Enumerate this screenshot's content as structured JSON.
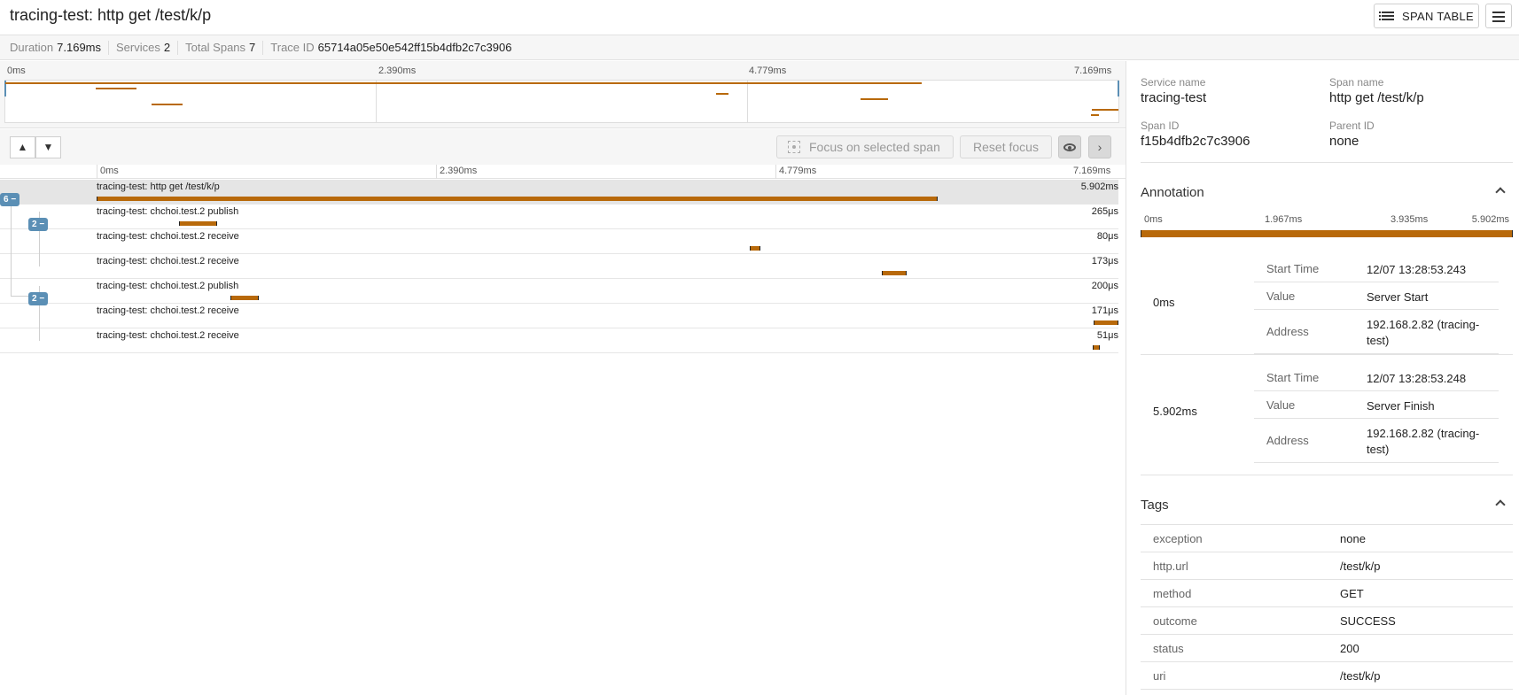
{
  "header": {
    "title": "tracing-test: http get /test/k/p",
    "span_table_label": "SPAN TABLE"
  },
  "stats": {
    "duration_label": "Duration",
    "duration_value": "7.169ms",
    "services_label": "Services",
    "services_value": "2",
    "spans_label": "Total Spans",
    "spans_value": "7",
    "trace_id_label": "Trace ID",
    "trace_id_value": "65714a05e50e542ff15b4dfb2c7c3906"
  },
  "timeline": {
    "ticks": [
      "0ms",
      "2.390ms",
      "4.779ms",
      "7.169ms"
    ],
    "total_ms": 7.169
  },
  "toolbar": {
    "focus_label": "Focus on selected span",
    "reset_label": "Reset focus"
  },
  "spans": [
    {
      "name": "tracing-test: http get /test/k/p",
      "duration": "5.902ms",
      "start_ms": 0.0,
      "dur_ms": 5.902,
      "depth": 0,
      "selected": true
    },
    {
      "name": "tracing-test: chchoi.test.2 publish",
      "duration": "265μs",
      "start_ms": 0.58,
      "dur_ms": 0.265,
      "depth": 1
    },
    {
      "name": "tracing-test: chchoi.test.2 receive",
      "duration": "80μs",
      "start_ms": 4.58,
      "dur_ms": 0.08,
      "depth": 2
    },
    {
      "name": "tracing-test: chchoi.test.2 receive",
      "duration": "173μs",
      "start_ms": 5.51,
      "dur_ms": 0.173,
      "depth": 2
    },
    {
      "name": "tracing-test: chchoi.test.2 publish",
      "duration": "200μs",
      "start_ms": 0.94,
      "dur_ms": 0.2,
      "depth": 1
    },
    {
      "name": "tracing-test: chchoi.test.2 receive",
      "duration": "171μs",
      "start_ms": 6.998,
      "dur_ms": 0.171,
      "depth": 2
    },
    {
      "name": "tracing-test: chchoi.test.2 receive",
      "duration": "51μs",
      "start_ms": 6.99,
      "dur_ms": 0.051,
      "depth": 2
    }
  ],
  "badges": [
    {
      "label": "6 −"
    },
    {
      "label": "2 −"
    },
    {
      "label": "2 −"
    }
  ],
  "detail": {
    "service_name_label": "Service name",
    "service_name_value": "tracing-test",
    "span_name_label": "Span name",
    "span_name_value": "http get /test/k/p",
    "span_id_label": "Span ID",
    "span_id_value": "f15b4dfb2c7c3906",
    "parent_id_label": "Parent ID",
    "parent_id_value": "none",
    "annotation_title": "Annotation",
    "annotation_ticks": [
      "0ms",
      "1.967ms",
      "3.935ms",
      "5.902ms"
    ],
    "annotations": [
      {
        "time": "0ms",
        "rows": [
          {
            "key": "Start Time",
            "value": "12/07 13:28:53.243"
          },
          {
            "key": "Value",
            "value": "Server Start"
          },
          {
            "key": "Address",
            "value": "192.168.2.82 (tracing-test)"
          }
        ]
      },
      {
        "time": "5.902ms",
        "rows": [
          {
            "key": "Start Time",
            "value": "12/07 13:28:53.248"
          },
          {
            "key": "Value",
            "value": "Server Finish"
          },
          {
            "key": "Address",
            "value": "192.168.2.82 (tracing-test)"
          }
        ]
      }
    ],
    "tags_title": "Tags",
    "tags": [
      {
        "key": "exception",
        "value": "none"
      },
      {
        "key": "http.url",
        "value": "/test/k/p"
      },
      {
        "key": "method",
        "value": "GET"
      },
      {
        "key": "outcome",
        "value": "SUCCESS"
      },
      {
        "key": "status",
        "value": "200"
      },
      {
        "key": "uri",
        "value": "/test/k/p"
      }
    ]
  },
  "colors": {
    "span_bar": "#b8690a",
    "badge": "#5b8fb5"
  }
}
